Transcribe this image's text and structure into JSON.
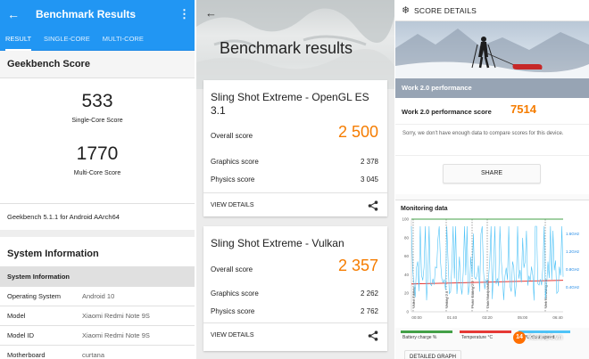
{
  "geekbench": {
    "title": "Benchmark Results",
    "tabs": [
      "RESULT",
      "SINGLE-CORE",
      "MULTI-CORE"
    ],
    "score_header": "Geekbench Score",
    "single_core_score": "533",
    "single_core_label": "Single-Core Score",
    "multi_core_score": "1770",
    "multi_core_label": "Multi-Core Score",
    "version": "Geekbench 5.1.1 for Android AArch64",
    "system_information_header": "System Information",
    "system_table": {
      "header": "System Information",
      "rows": [
        {
          "key": "Operating System",
          "value": "Android 10"
        },
        {
          "key": "Model",
          "value": "Xiaomi Redmi Note 9S"
        },
        {
          "key": "Model ID",
          "value": "Xiaomi Redmi Note 9S"
        },
        {
          "key": "Motherboard",
          "value": "curtana"
        }
      ]
    }
  },
  "threedmark": {
    "title": "Benchmark results",
    "cards": [
      {
        "name": "Sling Shot Extreme - OpenGL ES 3.1",
        "overall_label": "Overall score",
        "overall": "2 500",
        "graphics_label": "Graphics score",
        "graphics": "2 378",
        "physics_label": "Physics score",
        "physics": "3 045",
        "view_details": "VIEW DETAILS"
      },
      {
        "name": "Sling Shot Extreme - Vulkan",
        "overall_label": "Overall score",
        "overall": "2 357",
        "graphics_label": "Graphics score",
        "graphics": "2 262",
        "physics_label": "Physics score",
        "physics": "2 762",
        "view_details": "VIEW DETAILS"
      }
    ]
  },
  "pcmark": {
    "title": "SCORE DETAILS",
    "photo_caption": "Work 2.0 performance",
    "score_label": "Work 2.0 performance score",
    "score": "7514",
    "note": "Sorry, we don't have enough data to compare scores for this device.",
    "share_label": "SHARE",
    "monitoring_label": "Monitoring data",
    "detailed_graph_label": "DETAILED GRAPH",
    "legend": [
      "Battery charge %",
      "Temperature °C",
      "CPU clock speed"
    ],
    "y_left_ticks": [
      "100",
      "80",
      "60",
      "40",
      "20",
      "0"
    ],
    "y_right_ticks": [
      "1.6GHz",
      "1.2GHz",
      "0.8GHz",
      "0.4GHz"
    ],
    "x_ticks": [
      "00:00",
      "01:40",
      "03:20",
      "05:00",
      "06:40"
    ],
    "section_labels": [
      "Video Editing",
      "Writing 2.0",
      "Photo Editing 2.0",
      "Data Manipulation",
      "Web Browsing 2.0"
    ]
  },
  "watermark": {
    "badge": "14",
    "text": "Kenh14.vn"
  },
  "colors": {
    "geekbench_blue": "#2196f3",
    "accent_orange": "#f57c00",
    "cpu_line": "#4fc3f7",
    "battery": "#43a047",
    "temperature": "#e53935"
  },
  "chart_data": {
    "type": "line",
    "title": "Monitoring data",
    "xlabel": "",
    "ylabel": "",
    "x": [
      "00:00",
      "01:40",
      "03:20",
      "05:00",
      "06:40"
    ],
    "ylim": [
      0,
      100
    ],
    "series": [
      {
        "name": "Battery charge %",
        "values": [
          100,
          100,
          100,
          100,
          100
        ]
      },
      {
        "name": "Temperature °C",
        "values": [
          30,
          31,
          32,
          33,
          34
        ]
      }
    ],
    "grid": false
  }
}
